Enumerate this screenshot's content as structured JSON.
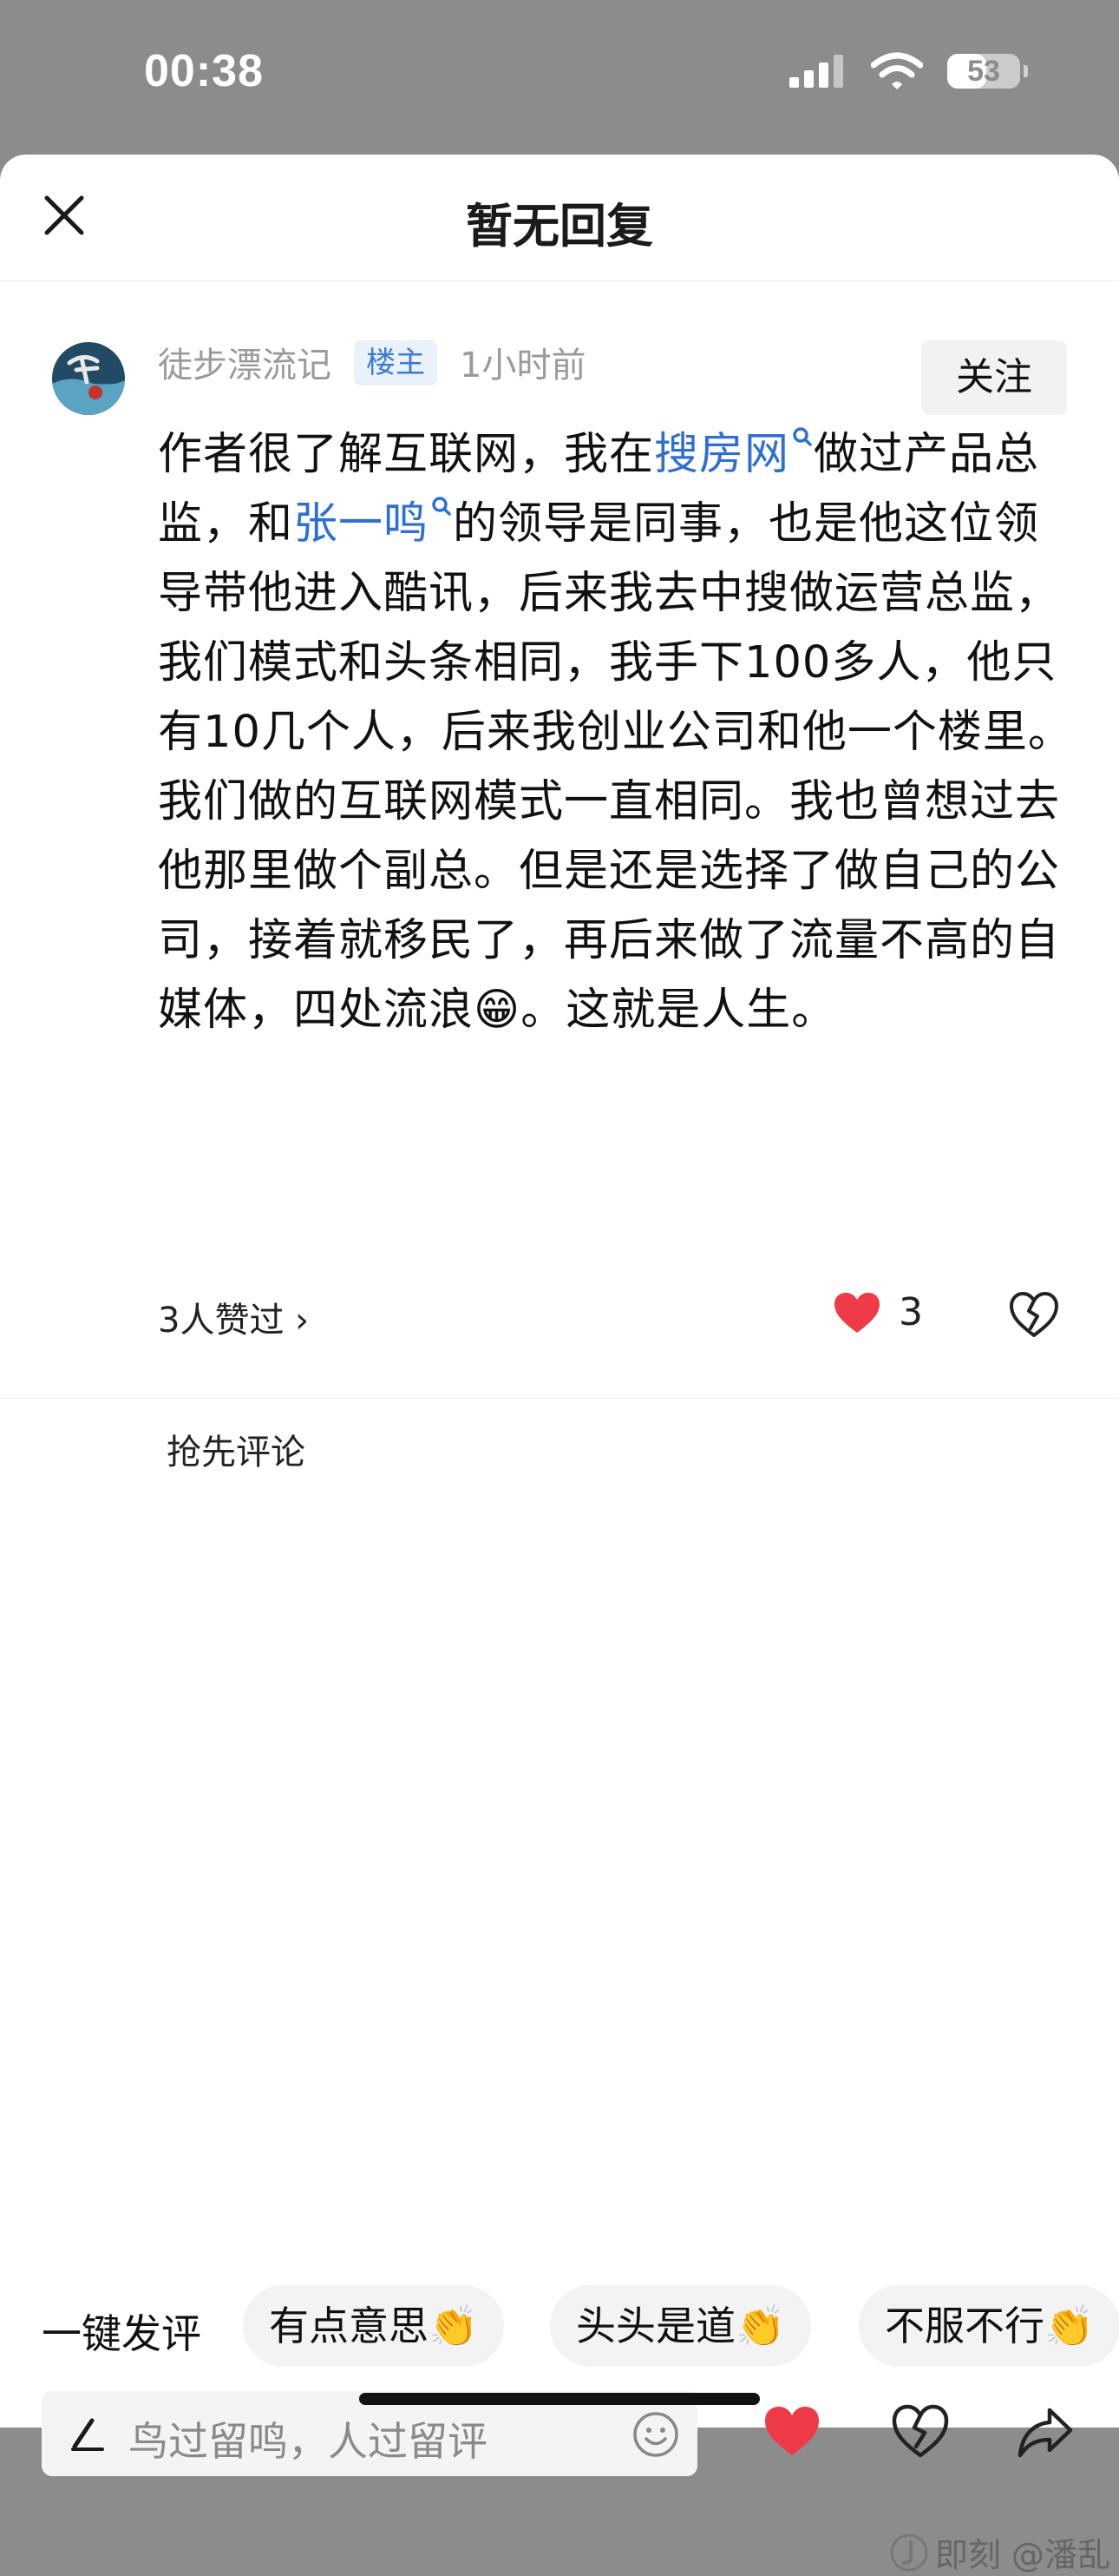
{
  "status_bar": {
    "time": "00:38",
    "battery": "53",
    "battery_level": 0.53
  },
  "header": {
    "title": "暂无回复"
  },
  "comment": {
    "username": "徒步漂流记",
    "badge": "楼主",
    "timestamp": "1小时前",
    "follow_label": "关注",
    "body": {
      "p1": "作者很了解互联网，我在",
      "link1": "搜房网",
      "p2": "做过产品总监，和",
      "link2": "张一鸣",
      "p3": "的领导是同事，也是他这位领导带他进入酷讯，后来我去中搜做运营总监，我们模式和头条相同，我手下100多人，他只有10几个人，后来我创业公司和他一个楼里。我们做的互联网模式一直相同。我也曾想过去他那里做个副总。但是还是选择了做自己的公司，接着就移民了，再后来做了流量不高的自媒体，四处流浪",
      "emoji": "😁",
      "p4": "。这就是人生。"
    },
    "likes_text": "3人赞过 ›",
    "like_count": "3"
  },
  "first_comment_label": "抢先评论",
  "quick_reply": {
    "label": "一键发评",
    "chips": [
      "有点意思👏",
      "头头是道👏",
      "不服不行👏"
    ]
  },
  "input": {
    "placeholder": "鸟过留鸣，人过留评"
  },
  "watermark": "即刻 @潘乱",
  "colors": {
    "like_red": "#ef3a47",
    "link_blue": "#2e6fd1",
    "badge_bg": "#e9f1fb",
    "status_gray": "#8c8c8c"
  }
}
